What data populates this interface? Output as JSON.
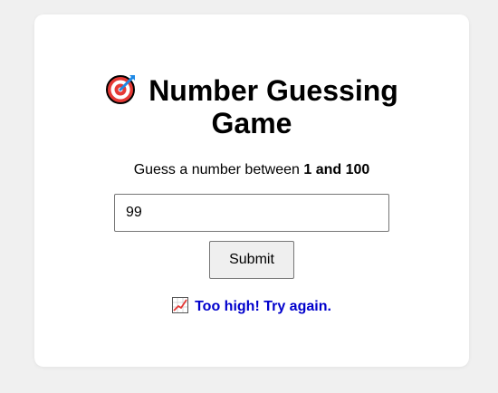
{
  "game": {
    "title_line1": "Number Guessing",
    "title_line2": "Game",
    "title_icon": "direct-hit-target-icon",
    "instruction_prefix": "Guess a number between ",
    "instruction_range": "1 and 100",
    "guess_value": "99",
    "submit_label": "Submit",
    "feedback_icon": "chart-increasing-icon",
    "feedback_text": "Too high! Try again.",
    "feedback_color": "#0000cc"
  }
}
